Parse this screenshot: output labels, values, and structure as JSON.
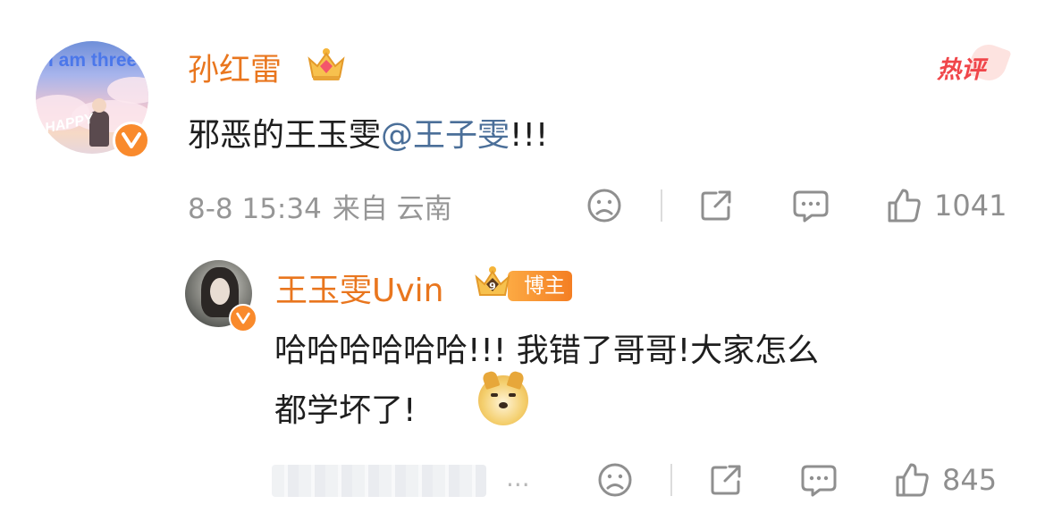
{
  "main_comment": {
    "avatar_text": "I am three",
    "avatar_text2": "HAPPY",
    "username": "孙红雷",
    "hot_label": "热评",
    "text_prefix": "邪恶的王玉雯",
    "mention": "@王子雯",
    "text_suffix": "!!!",
    "date": "8-8 15:34",
    "source": "来自 云南",
    "like_count": "1041"
  },
  "reply": {
    "username": "王玉雯Uvin",
    "crown_level": "9",
    "host_badge": "博主",
    "text_line1": "哈哈哈哈哈哈!!! 我错了哥哥!大家怎么",
    "text_line2": "都学坏了!",
    "more_text": "...",
    "like_count": "845"
  },
  "colors": {
    "username": "#e9761e",
    "mention": "#4b6f99",
    "hot": "#f0464a",
    "meta": "#969696",
    "verified_badge": "#f98a2c"
  },
  "icons": [
    "dislike-face-icon",
    "share-icon",
    "comment-icon",
    "thumbs-up-icon",
    "crown-icon",
    "doge-emoji-icon",
    "verified-v-icon"
  ]
}
